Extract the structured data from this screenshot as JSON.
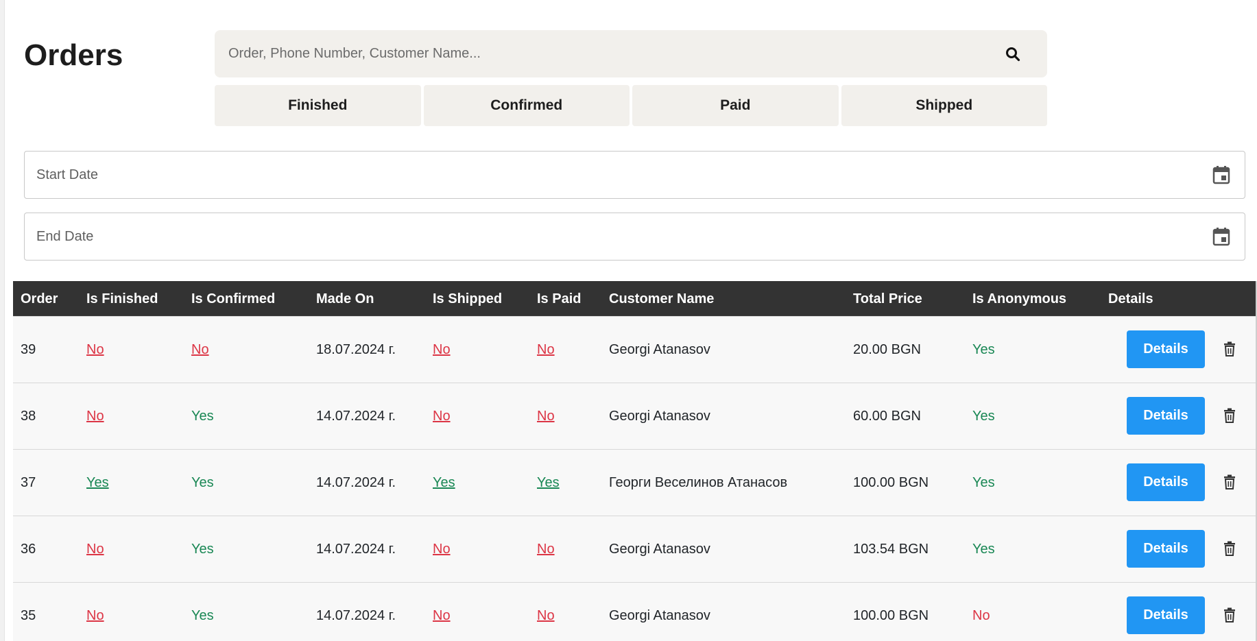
{
  "page": {
    "title": "Orders"
  },
  "search": {
    "placeholder": "Order, Phone Number, Customer Name...",
    "icon": "search-icon"
  },
  "filters": [
    "Finished",
    "Confirmed",
    "Paid",
    "Shipped"
  ],
  "dates": {
    "start_label": "Start Date",
    "end_label": "End Date",
    "icon": "calendar-icon"
  },
  "table": {
    "headers": [
      "Order",
      "Is Finished",
      "Is Confirmed",
      "Made On",
      "Is Shipped",
      "Is Paid",
      "Customer Name",
      "Total Price",
      "Is Anonymous",
      "Details"
    ],
    "details_label": "Details",
    "rows": [
      {
        "order": "39",
        "finished": "No",
        "confirmed": "No",
        "made_on": "18.07.2024 г.",
        "shipped": "No",
        "paid": "No",
        "customer": "Georgi Atanasov",
        "total": "20.00 BGN",
        "anonymous": "Yes"
      },
      {
        "order": "38",
        "finished": "No",
        "confirmed": "Yes",
        "made_on": "14.07.2024 г.",
        "shipped": "No",
        "paid": "No",
        "customer": "Georgi Atanasov",
        "total": "60.00 BGN",
        "anonymous": "Yes"
      },
      {
        "order": "37",
        "finished": "Yes",
        "confirmed": "Yes",
        "made_on": "14.07.2024 г.",
        "shipped": "Yes",
        "paid": "Yes",
        "customer": "Георги Веселинов Атанасов",
        "total": "100.00 BGN",
        "anonymous": "Yes"
      },
      {
        "order": "36",
        "finished": "No",
        "confirmed": "Yes",
        "made_on": "14.07.2024 г.",
        "shipped": "No",
        "paid": "No",
        "customer": "Georgi Atanasov",
        "total": "103.54 BGN",
        "anonymous": "Yes"
      },
      {
        "order": "35",
        "finished": "No",
        "confirmed": "Yes",
        "made_on": "14.07.2024 г.",
        "shipped": "No",
        "paid": "No",
        "customer": "Georgi Atanasov",
        "total": "100.00 BGN",
        "anonymous": "No"
      }
    ]
  },
  "colors": {
    "header_bg": "#333333",
    "details_button": "#2196f3",
    "yes": "#198754",
    "no": "#dc3545",
    "filter_bg": "#f2f0ec"
  }
}
